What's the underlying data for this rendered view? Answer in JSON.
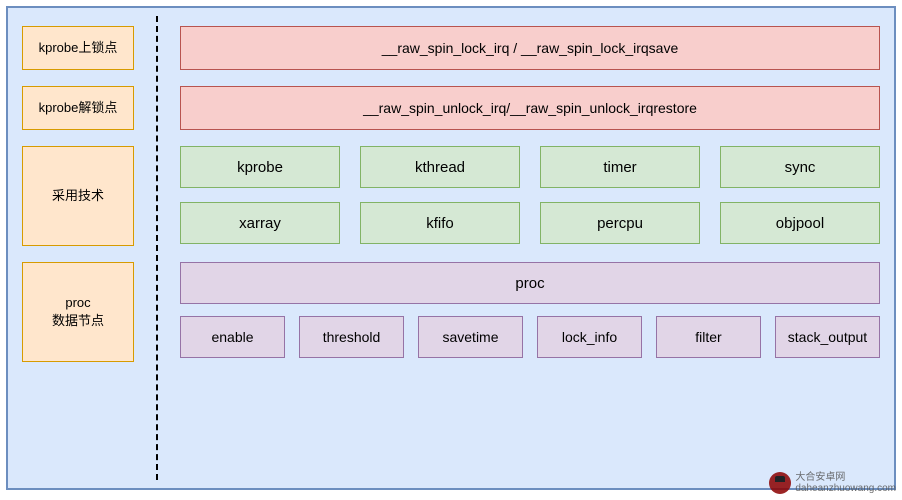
{
  "rows": {
    "lock_point": {
      "label": "kprobe上锁点",
      "content": "__raw_spin_lock_irq  /  __raw_spin_lock_irqsave"
    },
    "unlock_point": {
      "label": "kprobe解锁点",
      "content": "__raw_spin_unlock_irq/__raw_spin_unlock_irqrestore"
    },
    "tech": {
      "label": "采用技术",
      "items": [
        "kprobe",
        "kthread",
        "timer",
        "sync",
        "xarray",
        "kfifo",
        "percpu",
        "objpool"
      ]
    },
    "proc": {
      "label": "proc\n数据节点",
      "header": "proc",
      "items": [
        "enable",
        "threshold",
        "savetime",
        "lock_info",
        "filter",
        "stack_output"
      ]
    }
  },
  "watermark": {
    "title": "大合安卓网",
    "url": "daheanzhuowang.com"
  },
  "colors": {
    "container_bg": "#dae8fc",
    "container_border": "#6c8ebf",
    "label_bg": "#ffe6cc",
    "label_border": "#d79b00",
    "pink_bg": "#f8cecc",
    "pink_border": "#b85450",
    "green_bg": "#d5e8d4",
    "green_border": "#82b366",
    "purple_bg": "#e1d5e7",
    "purple_border": "#9673a6"
  }
}
